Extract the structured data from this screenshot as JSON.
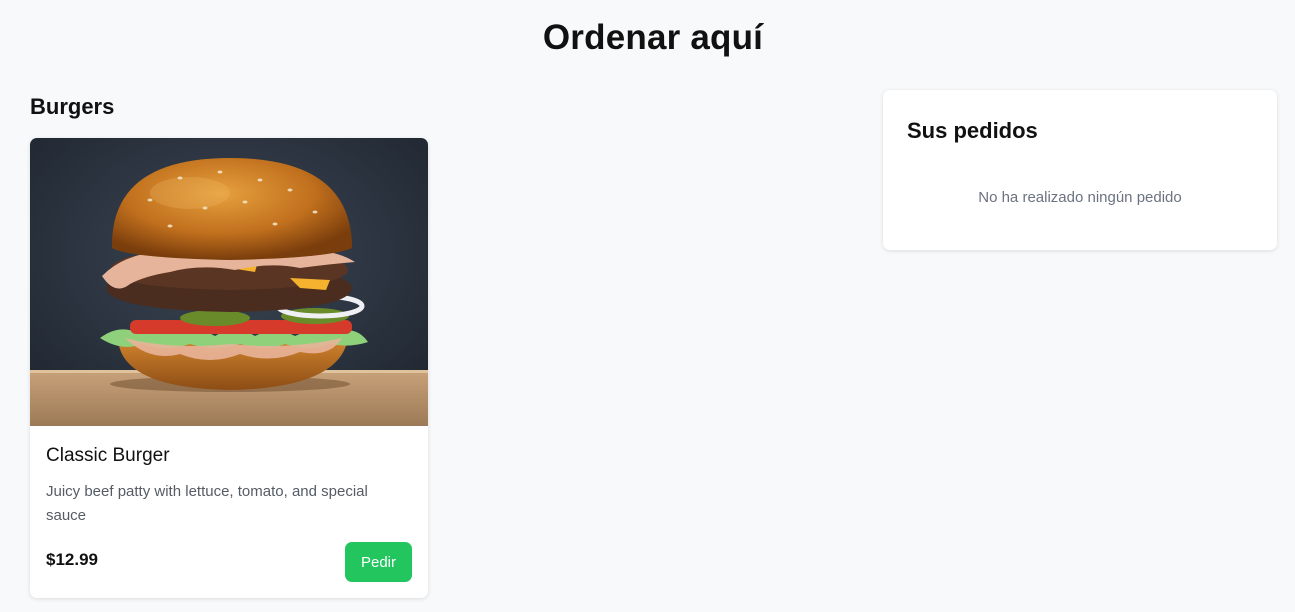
{
  "header": {
    "title": "Ordenar aquí"
  },
  "menu": {
    "category_title": "Burgers",
    "products": [
      {
        "name": "Classic Burger",
        "description": "Juicy beef patty with lettuce, tomato, and special sauce",
        "price": "$12.99",
        "button_label": "Pedir",
        "image": "burger-photo"
      }
    ]
  },
  "orders": {
    "title": "Sus pedidos",
    "empty_message": "No ha realizado ningún pedido"
  },
  "colors": {
    "background": "#f8f9fb",
    "card": "#ffffff",
    "accent_green": "#22c55e",
    "muted_text": "#6b7280"
  }
}
